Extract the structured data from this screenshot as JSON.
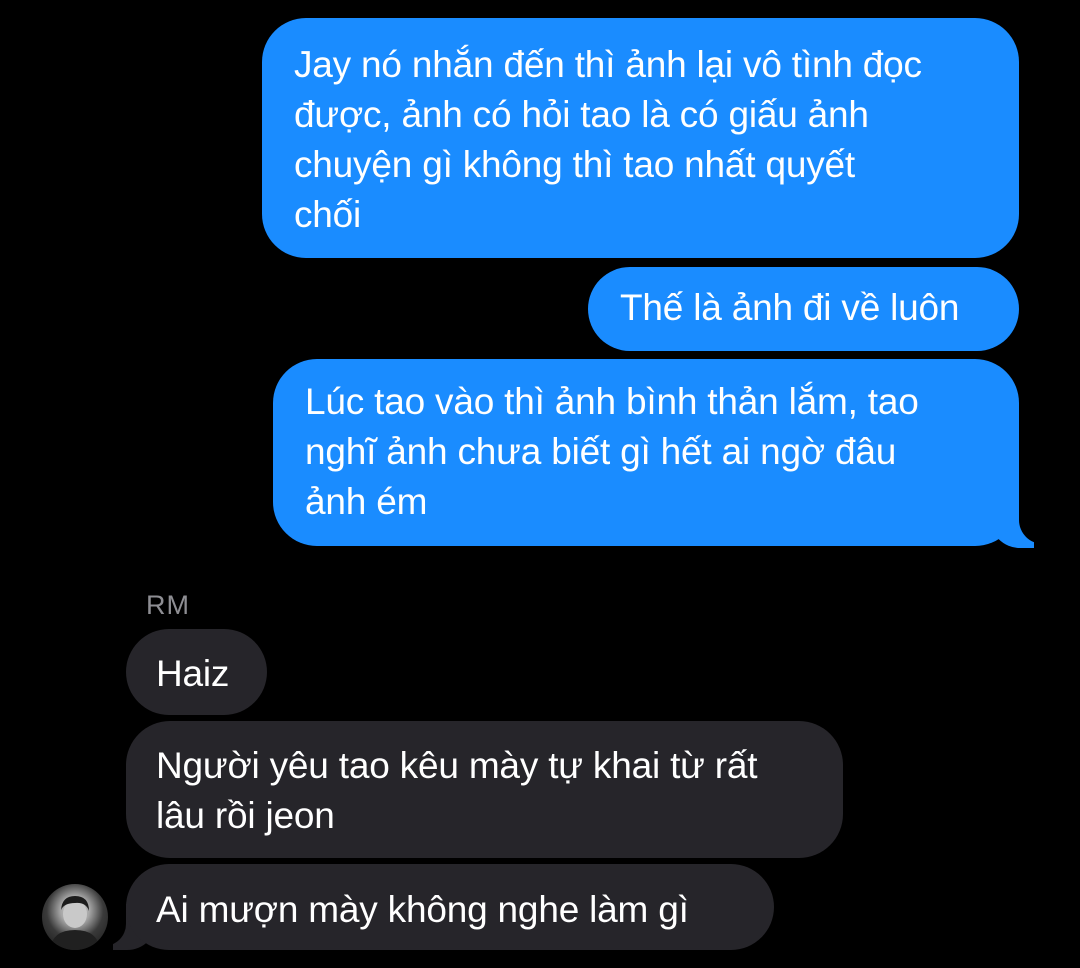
{
  "conversation": {
    "messages": [
      {
        "direction": "outgoing",
        "text": "Jay nó nhắn đến thì ảnh lại vô tình đọc\nđược, ảnh có hỏi tao là có giấu ảnh\nchuyện gì không thì tao nhất quyết\nchối"
      },
      {
        "direction": "outgoing",
        "text": "Thế là ảnh đi về luôn"
      },
      {
        "direction": "outgoing",
        "text": "Lúc tao vào thì ảnh bình thản lắm, tao\nnghĩ ảnh chưa biết gì hết ai ngờ đâu\nảnh ém"
      },
      {
        "direction": "incoming",
        "text": "Haiz"
      },
      {
        "direction": "incoming",
        "text": "Người yêu tao kêu mày tự khai từ rất\nlâu rồi jeon"
      },
      {
        "direction": "incoming",
        "text": "Ai mượn mày không nghe làm gì"
      }
    ],
    "incoming_sender": "RM"
  },
  "colors": {
    "background": "#000000",
    "sent_bubble": "#1a8cff",
    "received_bubble": "#26252a",
    "sender_name": "#8e8e93",
    "text": "#ffffff"
  },
  "icons": {
    "avatar": "contact-avatar-photo"
  }
}
